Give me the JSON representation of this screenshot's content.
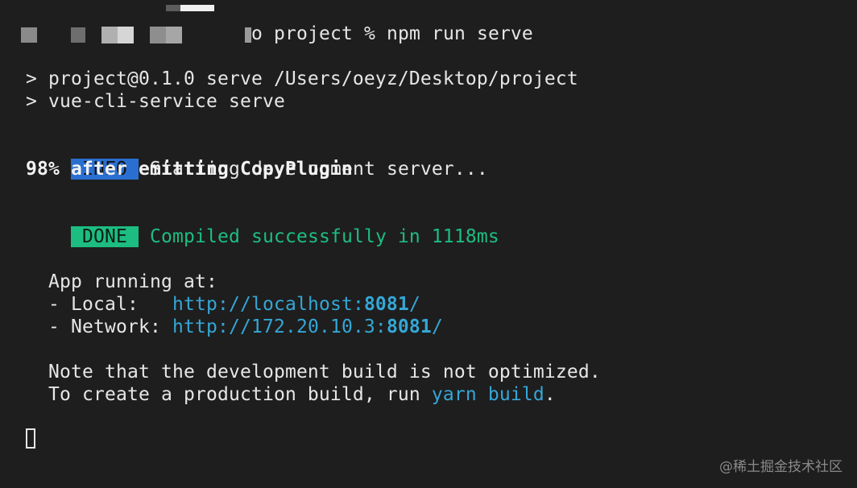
{
  "prompt": {
    "command": "o project % npm run serve"
  },
  "output": {
    "script_header_1": "> project@0.1.0 serve /Users/oeyz/Desktop/project",
    "script_header_2": "> vue-cli-service serve",
    "info_badge": "INFO",
    "info_text": "Starting development server...",
    "progress_text": "98% after emitting CopyPlugin",
    "done_badge": "DONE",
    "done_text": "Compiled successfully in 1118ms",
    "app_running": "App running at:",
    "local_label": "- Local:   ",
    "local_url_base": "http://localhost:",
    "local_url_port": "8081",
    "local_url_tail": "/",
    "network_label": "- Network: ",
    "network_url_base": "http://172.20.10.3:",
    "network_url_port": "8081",
    "network_url_tail": "/",
    "note_line": "Note that the development build is not optimized.",
    "build_prefix": "To create a production build, run ",
    "build_cmd": "yarn build",
    "build_suffix": "."
  },
  "watermark": "@稀土掘金技术社区",
  "colors": {
    "background": "#1e1e1e",
    "text": "#e6e6e6",
    "info_badge": "#2a6fd0",
    "done_green": "#1dbd82",
    "link_cyan": "#34a7d6"
  }
}
